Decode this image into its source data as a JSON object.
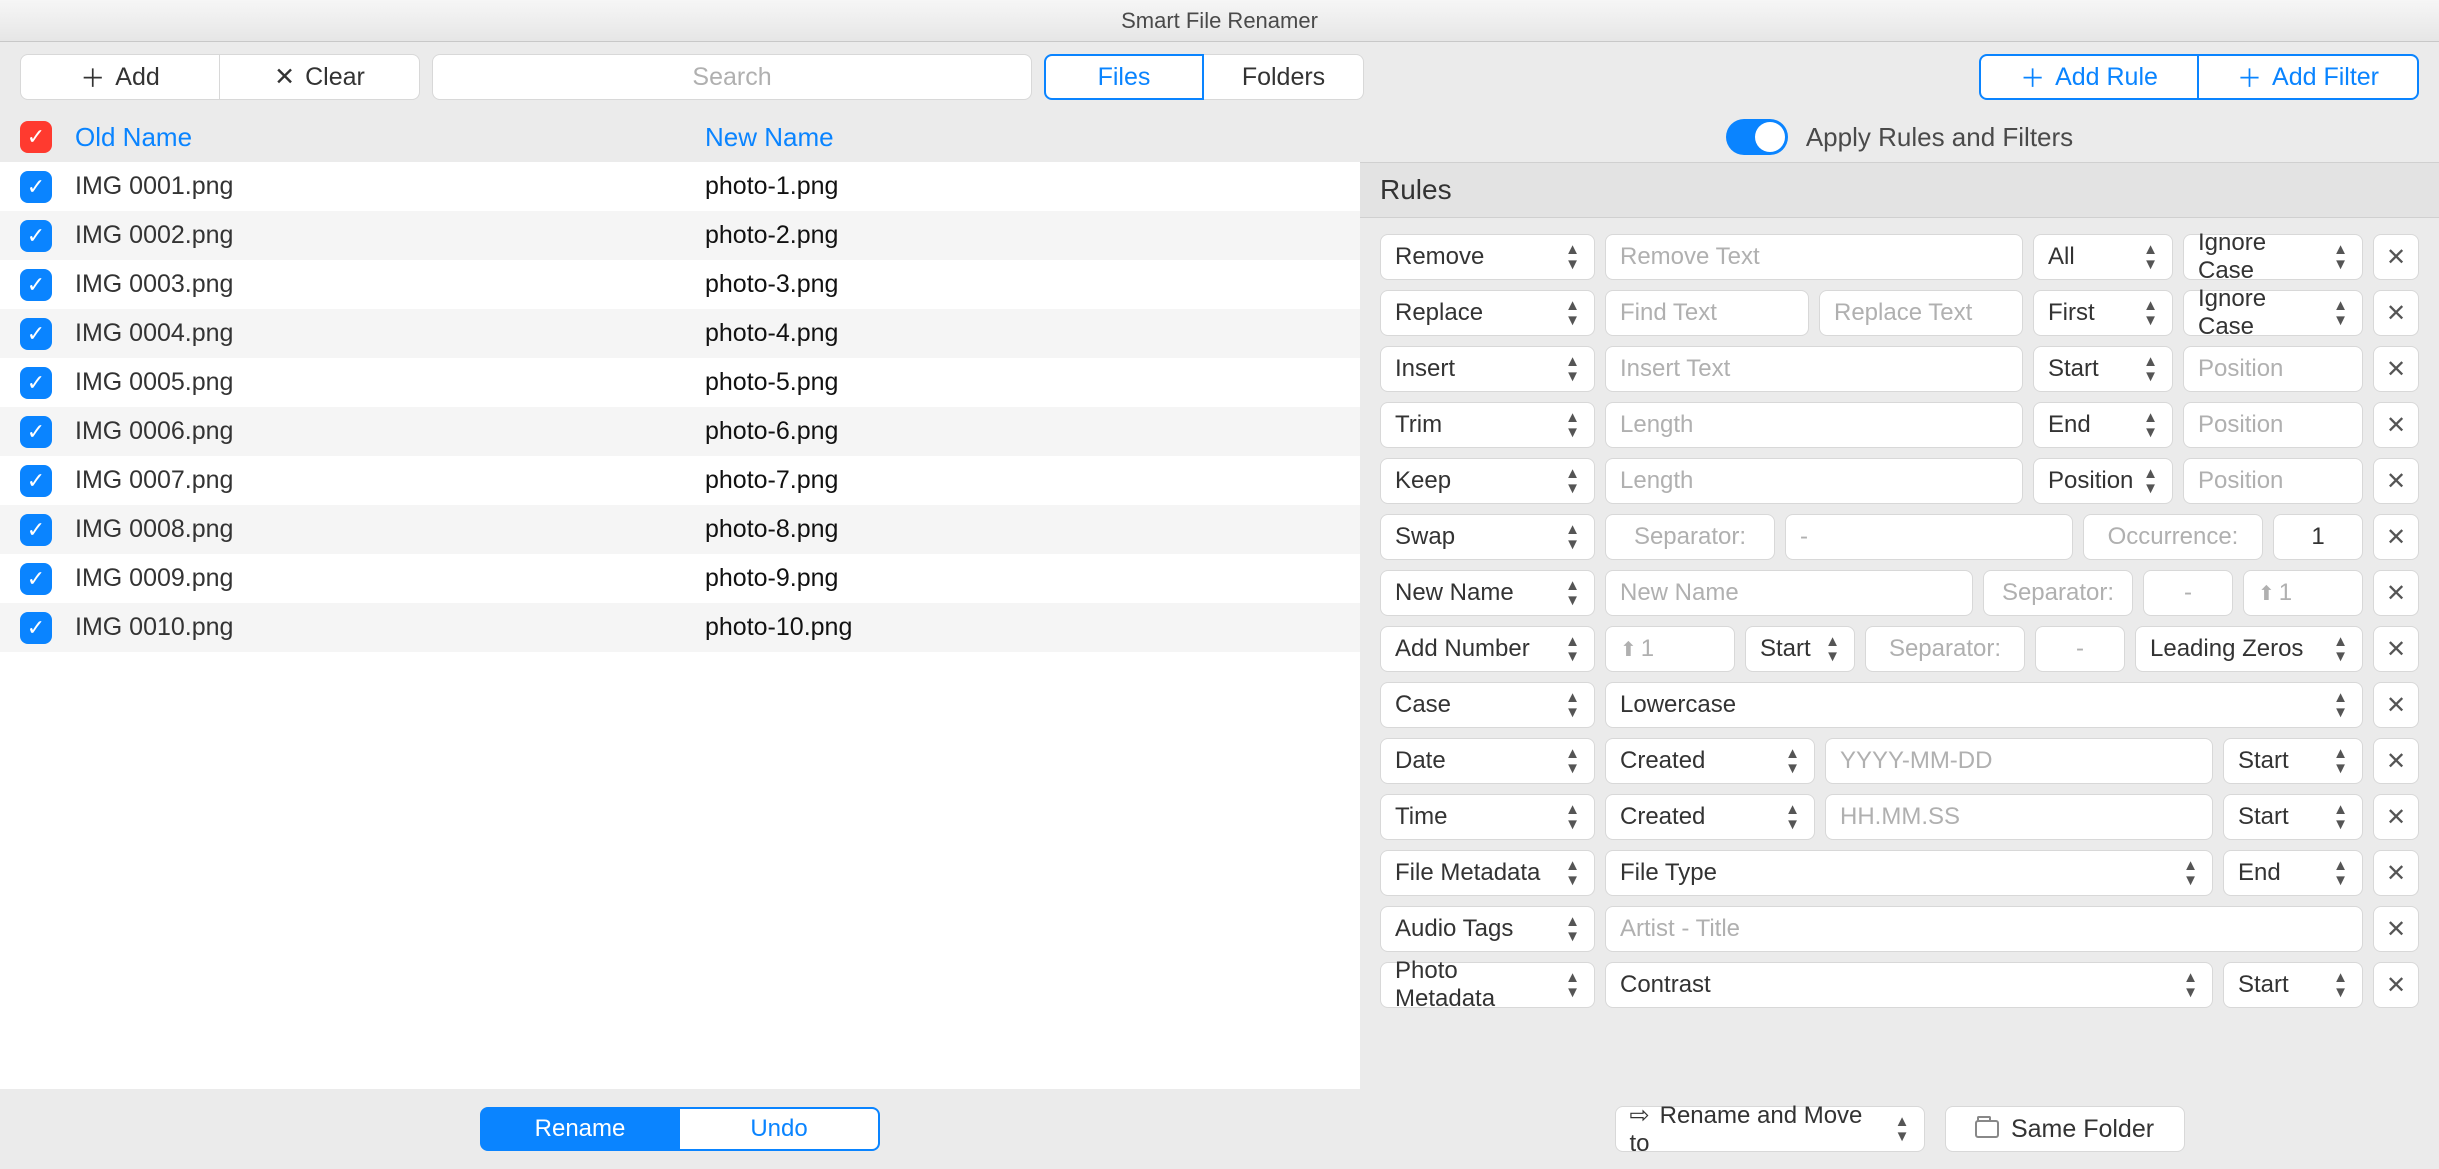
{
  "title": "Smart File Renamer",
  "topbar": {
    "add": "Add",
    "clear": "Clear",
    "search_placeholder": "Search",
    "files_tab": "Files",
    "folders_tab": "Folders",
    "add_rule": "Add Rule",
    "add_filter": "Add Filter"
  },
  "apply_label": "Apply Rules and Filters",
  "columns": {
    "old": "Old Name",
    "new": "New Name"
  },
  "files": [
    {
      "old": "IMG 0001.png",
      "new": "photo-1.png"
    },
    {
      "old": "IMG 0002.png",
      "new": "photo-2.png"
    },
    {
      "old": "IMG 0003.png",
      "new": "photo-3.png"
    },
    {
      "old": "IMG 0004.png",
      "new": "photo-4.png"
    },
    {
      "old": "IMG 0005.png",
      "new": "photo-5.png"
    },
    {
      "old": "IMG 0006.png",
      "new": "photo-6.png"
    },
    {
      "old": "IMG 0007.png",
      "new": "photo-7.png"
    },
    {
      "old": "IMG 0008.png",
      "new": "photo-8.png"
    },
    {
      "old": "IMG 0009.png",
      "new": "photo-9.png"
    },
    {
      "old": "IMG 0010.png",
      "new": "photo-10.png"
    }
  ],
  "rules_header": "Rules",
  "labels": {
    "remove": "Remove",
    "remove_text": "Remove Text",
    "all": "All",
    "ignore_case": "Ignore Case",
    "replace": "Replace",
    "find_text": "Find Text",
    "replace_text": "Replace Text",
    "first": "First",
    "insert": "Insert",
    "insert_text": "Insert Text",
    "start": "Start",
    "position": "Position",
    "trim": "Trim",
    "length": "Length",
    "end": "End",
    "keep": "Keep",
    "position_sel": "Position",
    "swap": "Swap",
    "separator_lbl": "Separator:",
    "dash": "-",
    "occurrence_lbl": "Occurrence:",
    "one": "1",
    "new_name": "New Name",
    "new_name_ph": "New Name",
    "sep_lbl2": "Separator:",
    "dash2": "-",
    "up1": "1",
    "add_number": "Add Number",
    "leading_zeros": "Leading Zeros",
    "case": "Case",
    "lowercase": "Lowercase",
    "date": "Date",
    "created": "Created",
    "date_fmt": "YYYY-MM-DD",
    "time": "Time",
    "time_fmt": "HH.MM.SS",
    "file_meta": "File Metadata",
    "file_type": "File Type",
    "audio": "Audio Tags",
    "artist_title": "Artist - Title",
    "photo": "Photo Metadata",
    "contrast": "Contrast"
  },
  "footer": {
    "rename": "Rename",
    "undo": "Undo",
    "rename_move": "Rename and Move to",
    "same_folder": "Same Folder"
  }
}
